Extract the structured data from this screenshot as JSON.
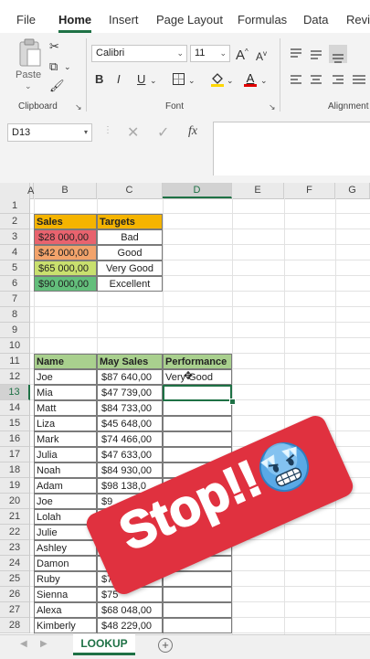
{
  "menu": {
    "items": [
      "File",
      "Home",
      "Insert",
      "Page Layout",
      "Formulas",
      "Data",
      "Revi"
    ],
    "active": "Home"
  },
  "ribbon": {
    "paste_label": "Paste",
    "clipboard_label": "Clipboard",
    "font_name": "Calibri",
    "font_size": "11",
    "font_label": "Font",
    "alignment_label": "Alignment",
    "bold": "B",
    "italic": "I",
    "underline": "U",
    "grow_font": "A",
    "shrink_font": "A",
    "font_color_letter": "A",
    "accent_color": "#1e7145"
  },
  "formula_bar": {
    "name_box": "D13",
    "fx_label": "fx",
    "formula": ""
  },
  "columns": [
    "A",
    "B",
    "C",
    "D",
    "E",
    "F",
    "G"
  ],
  "selected_column": "D",
  "rows": [
    "1",
    "2",
    "3",
    "4",
    "5",
    "6",
    "7",
    "8",
    "9",
    "10",
    "11",
    "12",
    "13",
    "14",
    "15",
    "16",
    "17",
    "18",
    "19",
    "20",
    "21",
    "22",
    "23",
    "24",
    "25",
    "26",
    "27",
    "28"
  ],
  "selected_row": "13",
  "targets_table": {
    "headers": [
      "Sales",
      "Targets"
    ],
    "header_color": "#f5b400",
    "rows": [
      {
        "sales": "$28 000,00",
        "target": "Bad",
        "color": "#e8636e"
      },
      {
        "sales": "$42 000,00",
        "target": "Good",
        "color": "#f2a36b"
      },
      {
        "sales": "$65 000,00",
        "target": "Very Good",
        "color": "#c9e06e"
      },
      {
        "sales": "$90 000,00",
        "target": "Excellent",
        "color": "#63be7b"
      }
    ]
  },
  "main_table": {
    "headers": [
      "Name",
      "May Sales",
      "Performance"
    ],
    "header_color": "#a9d08e",
    "rows": [
      {
        "name": "Joe",
        "sales": "$87 640,00",
        "performance": "Very Good"
      },
      {
        "name": "Mia",
        "sales": "$47 739,00",
        "performance": ""
      },
      {
        "name": "Matt",
        "sales": "$84 733,00",
        "performance": ""
      },
      {
        "name": "Liza",
        "sales": "$45 648,00",
        "performance": ""
      },
      {
        "name": "Mark",
        "sales": "$74 466,00",
        "performance": ""
      },
      {
        "name": "Julia",
        "sales": "$47 633,00",
        "performance": ""
      },
      {
        "name": "Noah",
        "sales": "$84 930,00",
        "performance": ""
      },
      {
        "name": "Adam",
        "sales": "$98 138,0",
        "performance": ""
      },
      {
        "name": "Joe",
        "sales": "$9",
        "performance": ""
      },
      {
        "name": "Lolah",
        "sales": "",
        "performance": ""
      },
      {
        "name": "Julie",
        "sales": "",
        "performance": ""
      },
      {
        "name": "Ashley",
        "sales": "",
        "performance": ""
      },
      {
        "name": "Damon",
        "sales": "",
        "performance": ""
      },
      {
        "name": "Ruby",
        "sales": "$7",
        "performance": ""
      },
      {
        "name": "Sienna",
        "sales": "$75",
        "performance": ""
      },
      {
        "name": "Alexa",
        "sales": "$68 048,00",
        "performance": ""
      },
      {
        "name": "Kimberly",
        "sales": "$48 229,00",
        "performance": ""
      }
    ]
  },
  "sheet_tabs": {
    "active": "LOOKUP",
    "add_icon": "plus-circle-icon"
  },
  "overlay": {
    "text": "Stop!!",
    "emoji": "freezing-face-icon",
    "color": "#e0313f"
  }
}
